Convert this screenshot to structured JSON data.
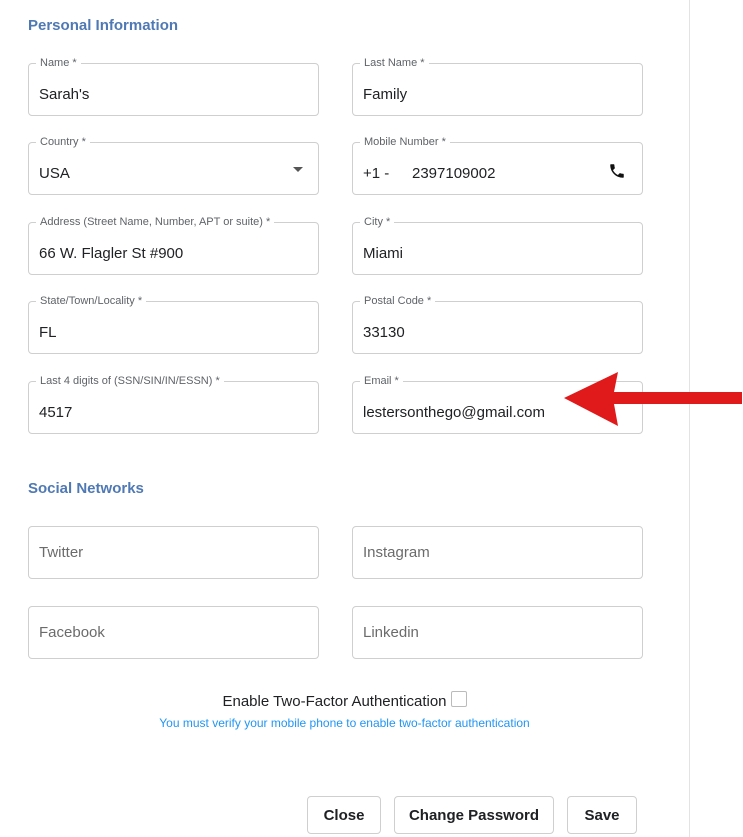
{
  "personal": {
    "title": "Personal Information",
    "name": {
      "label": "Name *",
      "value": "Sarah's"
    },
    "last_name": {
      "label": "Last Name *",
      "value": "Family"
    },
    "country": {
      "label": "Country *",
      "value": "USA"
    },
    "mobile": {
      "label": "Mobile Number *",
      "prefix": "+1 -",
      "value": "2397109002"
    },
    "address": {
      "label": "Address (Street Name, Number, APT or suite) *",
      "value": "66 W. Flagler St #900"
    },
    "city": {
      "label": "City *",
      "value": "Miami"
    },
    "state": {
      "label": "State/Town/Locality *",
      "value": "FL"
    },
    "postal": {
      "label": "Postal Code *",
      "value": "33130"
    },
    "ssn": {
      "label": "Last 4 digits of (SSN/SIN/IN/ESSN) *",
      "value": "4517"
    },
    "email": {
      "label": "Email *",
      "value": "lestersonthego@gmail.com"
    }
  },
  "social": {
    "title": "Social Networks",
    "twitter_placeholder": "Twitter",
    "instagram_placeholder": "Instagram",
    "facebook_placeholder": "Facebook",
    "linkedin_placeholder": "Linkedin"
  },
  "two_factor": {
    "label": "Enable Two-Factor Authentication",
    "checked": false,
    "note": "You must verify your mobile phone to enable two-factor authentication"
  },
  "buttons": {
    "close": "Close",
    "change_password": "Change Password",
    "save": "Save"
  },
  "colors": {
    "section_title": "#4f79b4",
    "note": "#2196f3",
    "arrow": "#e0191b"
  }
}
